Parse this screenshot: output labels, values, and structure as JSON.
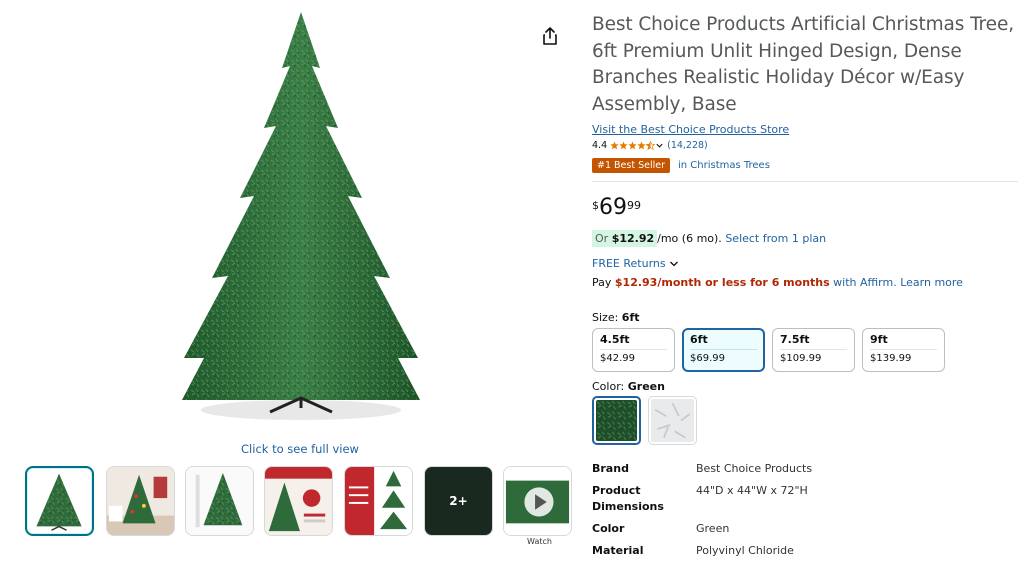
{
  "gallery": {
    "full_view_label": "Click to see full view",
    "more_count": "2+",
    "watch_label": "Watch",
    "thumbnails": [
      {
        "kind": "tree"
      },
      {
        "kind": "room"
      },
      {
        "kind": "tree-plain"
      },
      {
        "kind": "infographic-red"
      },
      {
        "kind": "assembly"
      },
      {
        "kind": "more"
      },
      {
        "kind": "video"
      }
    ]
  },
  "product": {
    "title": "Best Choice Products Artificial Christmas Tree, 6ft Premium Unlit Hinged Design, Dense Branches Realistic Holiday Décor w/Easy Assembly, Base",
    "store_link": "Visit the Best Choice Products Store",
    "rating": "4.4",
    "review_count": "(14,228)",
    "rating_stars": 4.4,
    "badge": "#1 Best Seller",
    "badge_category": "in Christmas Trees"
  },
  "price": {
    "symbol": "$",
    "whole": "69",
    "fraction": "99"
  },
  "financing": {
    "or_label": "Or",
    "monthly_amount": "$12.92",
    "monthly_suffix": "/mo (6 mo).",
    "select_plan": "Select from 1 plan",
    "returns": "FREE Returns",
    "affirm_pay": "Pay",
    "affirm_amount": "$12.93/month or less for 6 months",
    "affirm_with": "with Affirm.",
    "affirm_learn": "Learn more"
  },
  "size": {
    "label": "Size:",
    "selected": "6ft",
    "options": [
      {
        "size": "4.5ft",
        "price": "$42.99"
      },
      {
        "size": "6ft",
        "price": "$69.99"
      },
      {
        "size": "7.5ft",
        "price": "$109.99"
      },
      {
        "size": "9ft",
        "price": "$139.99"
      }
    ]
  },
  "color": {
    "label": "Color:",
    "selected": "Green",
    "options": [
      {
        "name": "green-swatch"
      },
      {
        "name": "white-swatch"
      }
    ]
  },
  "specs": [
    {
      "key": "Brand",
      "value": "Best Choice Products"
    },
    {
      "key": "Product Dimensions",
      "value": "44\"D x 44\"W x 72\"H"
    },
    {
      "key": "Color",
      "value": "Green"
    },
    {
      "key": "Material",
      "value": "Polyvinyl Chloride"
    }
  ],
  "colors": {
    "link": "#2162a1",
    "badge": "#c45500",
    "deal_red": "#b12704",
    "selected_border": "#2162a1",
    "tree_green": "#2f6b3a",
    "star": "#e67a00"
  }
}
